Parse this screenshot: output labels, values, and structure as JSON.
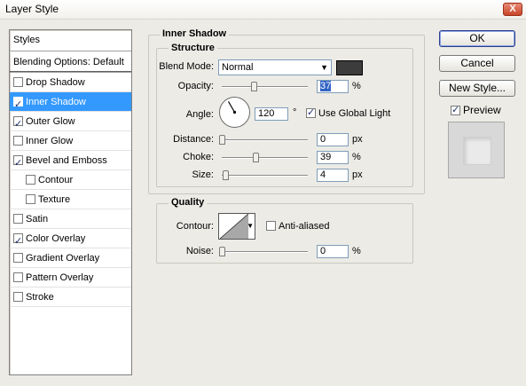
{
  "window": {
    "title": "Layer Style",
    "close_label": "X"
  },
  "styles_panel": {
    "header": "Styles",
    "blending_options": "Blending Options: Default",
    "items": [
      {
        "label": "Drop Shadow",
        "checked": false,
        "selected": false,
        "indent": false
      },
      {
        "label": "Inner Shadow",
        "checked": true,
        "selected": true,
        "indent": false
      },
      {
        "label": "Outer Glow",
        "checked": true,
        "selected": false,
        "indent": false
      },
      {
        "label": "Inner Glow",
        "checked": false,
        "selected": false,
        "indent": false
      },
      {
        "label": "Bevel and Emboss",
        "checked": true,
        "selected": false,
        "indent": false
      },
      {
        "label": "Contour",
        "checked": false,
        "selected": false,
        "indent": true
      },
      {
        "label": "Texture",
        "checked": false,
        "selected": false,
        "indent": true
      },
      {
        "label": "Satin",
        "checked": false,
        "selected": false,
        "indent": false
      },
      {
        "label": "Color Overlay",
        "checked": true,
        "selected": false,
        "indent": false
      },
      {
        "label": "Gradient Overlay",
        "checked": false,
        "selected": false,
        "indent": false
      },
      {
        "label": "Pattern Overlay",
        "checked": false,
        "selected": false,
        "indent": false
      },
      {
        "label": "Stroke",
        "checked": false,
        "selected": false,
        "indent": false
      }
    ]
  },
  "inner_shadow": {
    "title": "Inner Shadow",
    "structure": {
      "title": "Structure",
      "blend_mode_label": "Blend Mode:",
      "blend_mode_value": "Normal",
      "shadow_color": "#3c3c3c",
      "opacity_label": "Opacity:",
      "opacity_value": "37",
      "opacity_unit": "%",
      "opacity_level": 0.37,
      "angle_label": "Angle:",
      "angle_value": "120",
      "angle_unit": "°",
      "angle_degrees": 120,
      "use_global_light_label": "Use Global Light",
      "use_global_light_checked": true,
      "distance_label": "Distance:",
      "distance_value": "0",
      "distance_unit": "px",
      "distance_level": 0.0,
      "choke_label": "Choke:",
      "choke_value": "39",
      "choke_unit": "%",
      "choke_level": 0.39,
      "size_label": "Size:",
      "size_value": "4",
      "size_unit": "px",
      "size_level": 0.04
    },
    "quality": {
      "title": "Quality",
      "contour_label": "Contour:",
      "anti_aliased_label": "Anti-aliased",
      "anti_aliased_checked": false,
      "noise_label": "Noise:",
      "noise_value": "0",
      "noise_unit": "%",
      "noise_level": 0.0
    }
  },
  "buttons": {
    "ok": "OK",
    "cancel": "Cancel",
    "new_style": "New Style...",
    "preview_label": "Preview",
    "preview_checked": true
  },
  "icons": {
    "close": "close-icon",
    "dropdown": "chevron-down-icon",
    "check": "checkmark-icon"
  }
}
